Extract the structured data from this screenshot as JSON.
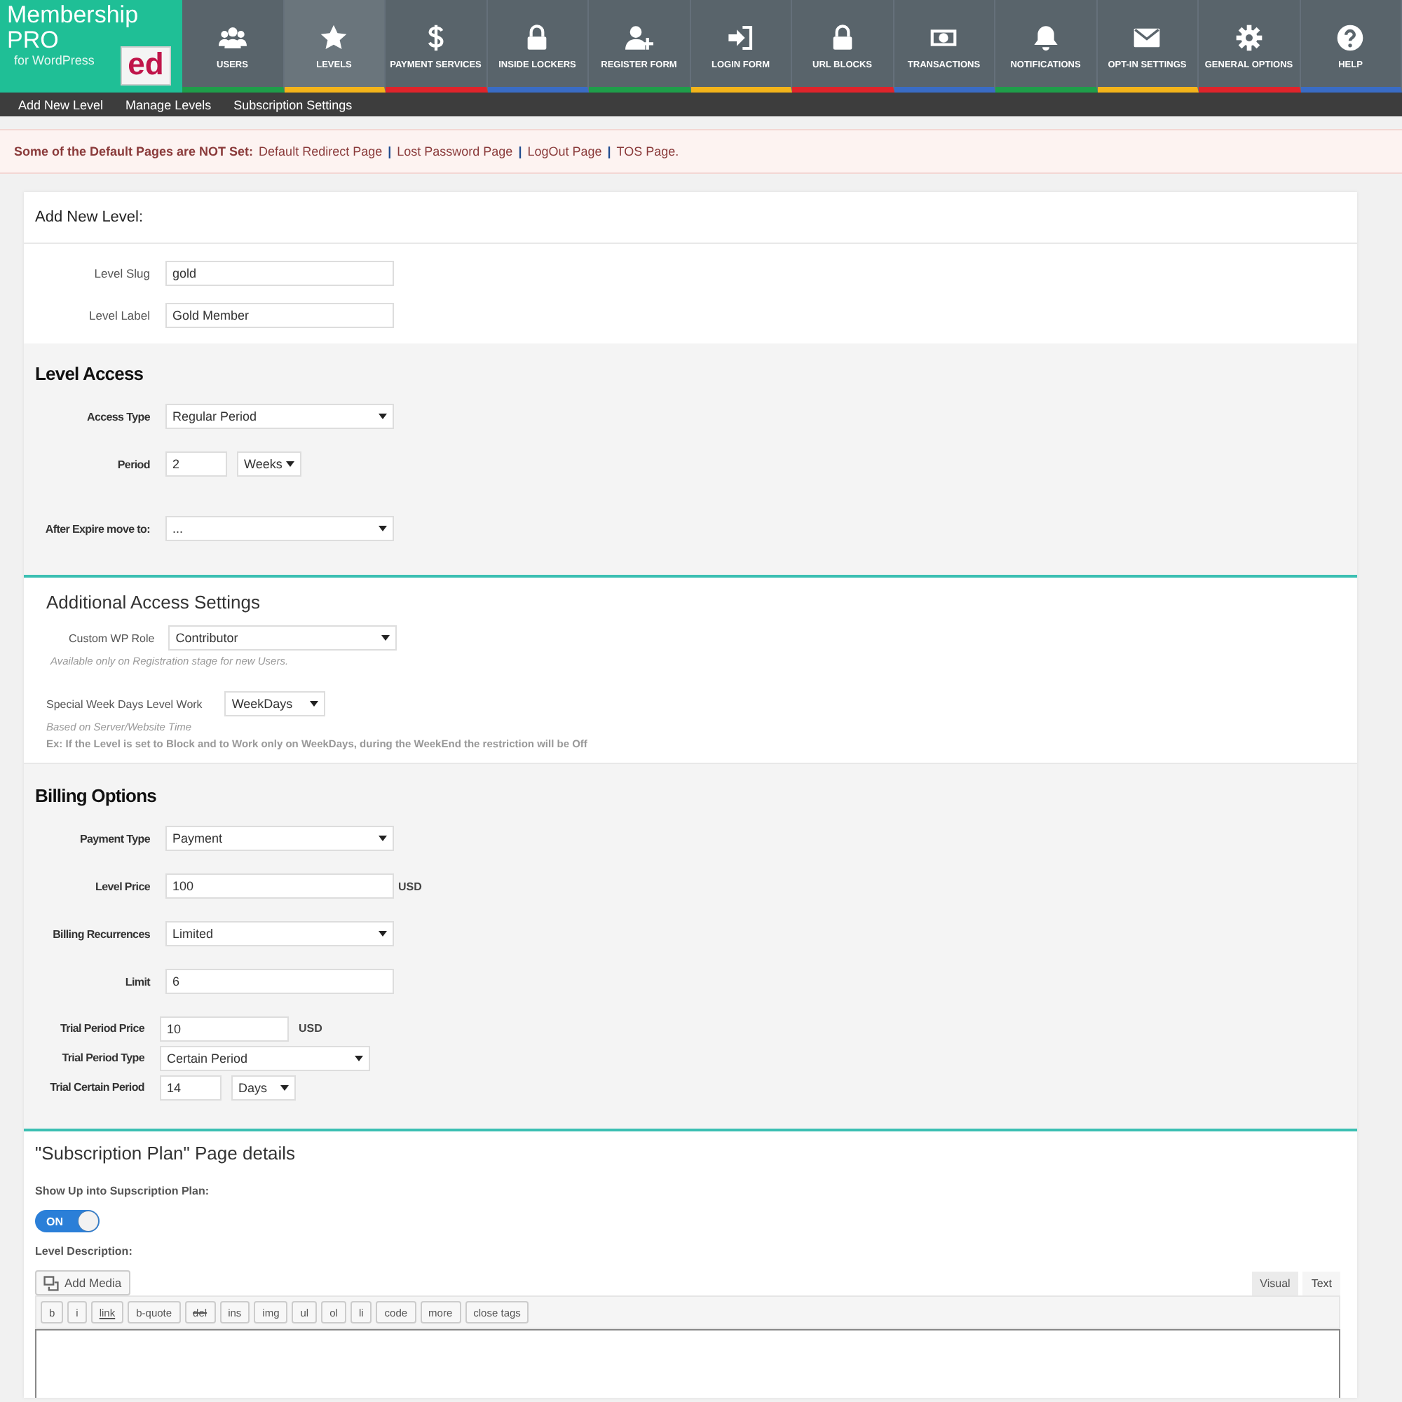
{
  "logo": {
    "title": "Membership",
    "subtitle": "PRO",
    "tagline": "for WordPress",
    "badge": "ed"
  },
  "nav": [
    {
      "label": "USERS",
      "kind": "users",
      "selected": false,
      "color": "#1f9e4a"
    },
    {
      "label": "LEVELS",
      "kind": "star",
      "selected": true,
      "color": "#f4b41a"
    },
    {
      "label": "PAYMENT SERVICES",
      "kind": "dollar",
      "selected": false,
      "color": "#e0242b"
    },
    {
      "label": "INSIDE LOCKERS",
      "kind": "lock",
      "selected": false,
      "color": "#3a6cc5"
    },
    {
      "label": "REGISTER FORM",
      "kind": "user-plus",
      "selected": false,
      "color": "#1f9e4a"
    },
    {
      "label": "LOGIN FORM",
      "kind": "login",
      "selected": false,
      "color": "#f4b41a"
    },
    {
      "label": "URL BLOCKS",
      "kind": "lock",
      "selected": false,
      "color": "#e0242b"
    },
    {
      "label": "TRANSACTIONS",
      "kind": "money",
      "selected": false,
      "color": "#3a6cc5"
    },
    {
      "label": "NOTIFICATIONS",
      "kind": "bell",
      "selected": false,
      "color": "#1f9e4a"
    },
    {
      "label": "OPT-IN SETTINGS",
      "kind": "envelope",
      "selected": false,
      "color": "#f4b41a"
    },
    {
      "label": "GENERAL OPTIONS",
      "kind": "gear",
      "selected": false,
      "color": "#e0242b"
    },
    {
      "label": "HELP",
      "kind": "help",
      "selected": false,
      "color": "#3a6cc5"
    }
  ],
  "subnav": [
    "Add New Level",
    "Manage Levels",
    "Subscription Settings"
  ],
  "notice": {
    "text": "Some of the Default Pages are NOT Set:",
    "links": [
      "Default Redirect Page",
      "Lost Password Page",
      "LogOut Page",
      "TOS Page."
    ],
    "separator": "|"
  },
  "card_title": "Add New Level:",
  "basic": [
    {
      "label": "Level Slug",
      "fields": [
        {
          "kind": "text",
          "value": "gold"
        }
      ]
    },
    {
      "label": "Level Label",
      "fields": [
        {
          "kind": "text",
          "value": "Gold Member"
        }
      ]
    }
  ],
  "level_access": {
    "title": "Level Access",
    "rows": [
      {
        "label": "Access Type",
        "fields": [
          {
            "kind": "select",
            "value": "Regular Period"
          }
        ]
      },
      {
        "label": "Period",
        "fields": [
          {
            "kind": "short",
            "value": "2"
          },
          {
            "kind": "small-select",
            "value": "Weeks"
          }
        ]
      },
      {
        "label": "After Expire move to:",
        "fields": [
          {
            "kind": "select",
            "value": "..."
          }
        ]
      }
    ]
  },
  "additional": {
    "title": "Additional Access Settings",
    "role_label": "Custom WP Role",
    "role": "Contributor",
    "role_hint": "Available only on Registration stage for new Users.",
    "week_label": "Special Week Days Level Work",
    "week": "WeekDays",
    "week_hint": "Based on Server/Website Time",
    "week_example": "Ex: If the Level is set to Block and to Work only on WeekDays, during the WeekEnd the restriction will be Off"
  },
  "billing": {
    "title": "Billing Options",
    "rows": [
      {
        "label": "Payment Type",
        "fields": [
          {
            "kind": "select",
            "value": "Payment"
          }
        ]
      },
      {
        "label": "Level Price",
        "fields": [
          {
            "kind": "text",
            "value": "100"
          }
        ],
        "suffix": "USD"
      },
      {
        "label": "Billing Recurrences",
        "fields": [
          {
            "kind": "select",
            "value": "Limited"
          }
        ]
      },
      {
        "label": "Limit",
        "fields": [
          {
            "kind": "text",
            "value": "6"
          }
        ]
      }
    ],
    "trial_rows": [
      {
        "label": "Trial Period Price",
        "fields": [
          {
            "kind": "medium",
            "value": "10"
          }
        ],
        "suffix": "USD"
      },
      {
        "label": "Trial Period Type",
        "fields": [
          {
            "kind": "wide-select",
            "value": "Certain Period"
          }
        ]
      },
      {
        "label": "Trial Certain Period",
        "fields": [
          {
            "kind": "short",
            "value": "14"
          },
          {
            "kind": "small-select",
            "value": "Days"
          }
        ]
      }
    ]
  },
  "subscription": {
    "title": "\"Subscription Plan\" Page details",
    "show_label": "Show Up into Supscription Plan:",
    "toggle": {
      "label": "ON",
      "on": true
    },
    "description_label": "Level Description:",
    "add_media": "Add Media",
    "editor_tabs": [
      {
        "label": "Visual",
        "selected": false
      },
      {
        "label": "Text",
        "selected": true
      }
    ],
    "quicktags": [
      {
        "label": "b",
        "kind": "plain"
      },
      {
        "label": "i",
        "kind": "plain"
      },
      {
        "label": "link",
        "kind": "underline"
      },
      {
        "label": "b-quote",
        "kind": "plain"
      },
      {
        "label": "del",
        "kind": "strike"
      },
      {
        "label": "ins",
        "kind": "plain"
      },
      {
        "label": "img",
        "kind": "plain"
      },
      {
        "label": "ul",
        "kind": "plain"
      },
      {
        "label": "ol",
        "kind": "plain"
      },
      {
        "label": "li",
        "kind": "plain"
      },
      {
        "label": "code",
        "kind": "plain"
      },
      {
        "label": "more",
        "kind": "plain"
      },
      {
        "label": "close tags",
        "kind": "plain"
      }
    ]
  }
}
